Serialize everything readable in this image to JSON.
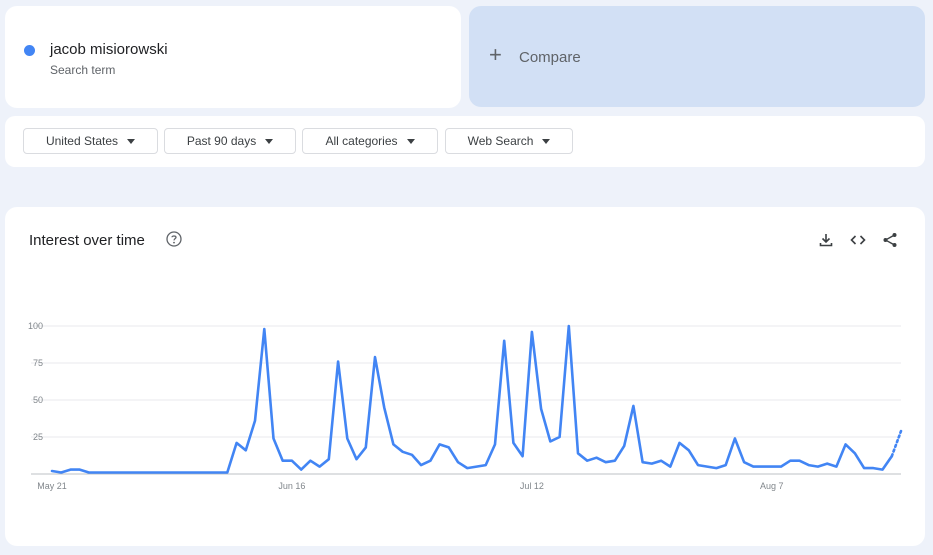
{
  "search_term": {
    "name": "jacob misiorowski",
    "subtitle": "Search term",
    "color": "#4285f4"
  },
  "compare": {
    "plus": "+",
    "label": "Compare"
  },
  "filters": [
    {
      "label": "United States"
    },
    {
      "label": "Past 90 days"
    },
    {
      "label": "All categories"
    },
    {
      "label": "Web Search"
    }
  ],
  "chart_card": {
    "title": "Interest over time",
    "icons": [
      "help-icon",
      "download-icon",
      "embed-code-icon",
      "share-icon"
    ]
  },
  "chart_data": {
    "type": "line",
    "title": "Interest over time",
    "xlabel": "",
    "ylabel": "",
    "ylim": [
      0,
      100
    ],
    "yticks": [
      25,
      50,
      75,
      100
    ],
    "x_tick_labels": [
      {
        "label": "May 21",
        "index": 0
      },
      {
        "label": "Jun 16",
        "index": 26
      },
      {
        "label": "Jul 12",
        "index": 52
      },
      {
        "label": "Aug 7",
        "index": 78
      }
    ],
    "grid": true,
    "series": [
      {
        "color": "#4285f4",
        "values": [
          2,
          1,
          3,
          3,
          1,
          1,
          1,
          1,
          1,
          1,
          1,
          1,
          1,
          1,
          1,
          1,
          1,
          1,
          1,
          1,
          21,
          16,
          36,
          98,
          24,
          9,
          9,
          3,
          9,
          5,
          10,
          76,
          24,
          10,
          18,
          79,
          45,
          20,
          15,
          13,
          6,
          9,
          20,
          18,
          8,
          4,
          5,
          6,
          20,
          90,
          21,
          12,
          96,
          44,
          22,
          25,
          100,
          14,
          9,
          11,
          8,
          9,
          19,
          46,
          8,
          7,
          9,
          5,
          21,
          16,
          6,
          5,
          4,
          6,
          24,
          8,
          5,
          5,
          5,
          5,
          9,
          9,
          6,
          5,
          7,
          5,
          20,
          14,
          4,
          4,
          3,
          12
        ],
        "partial_values": [
          12,
          29
        ]
      }
    ]
  }
}
